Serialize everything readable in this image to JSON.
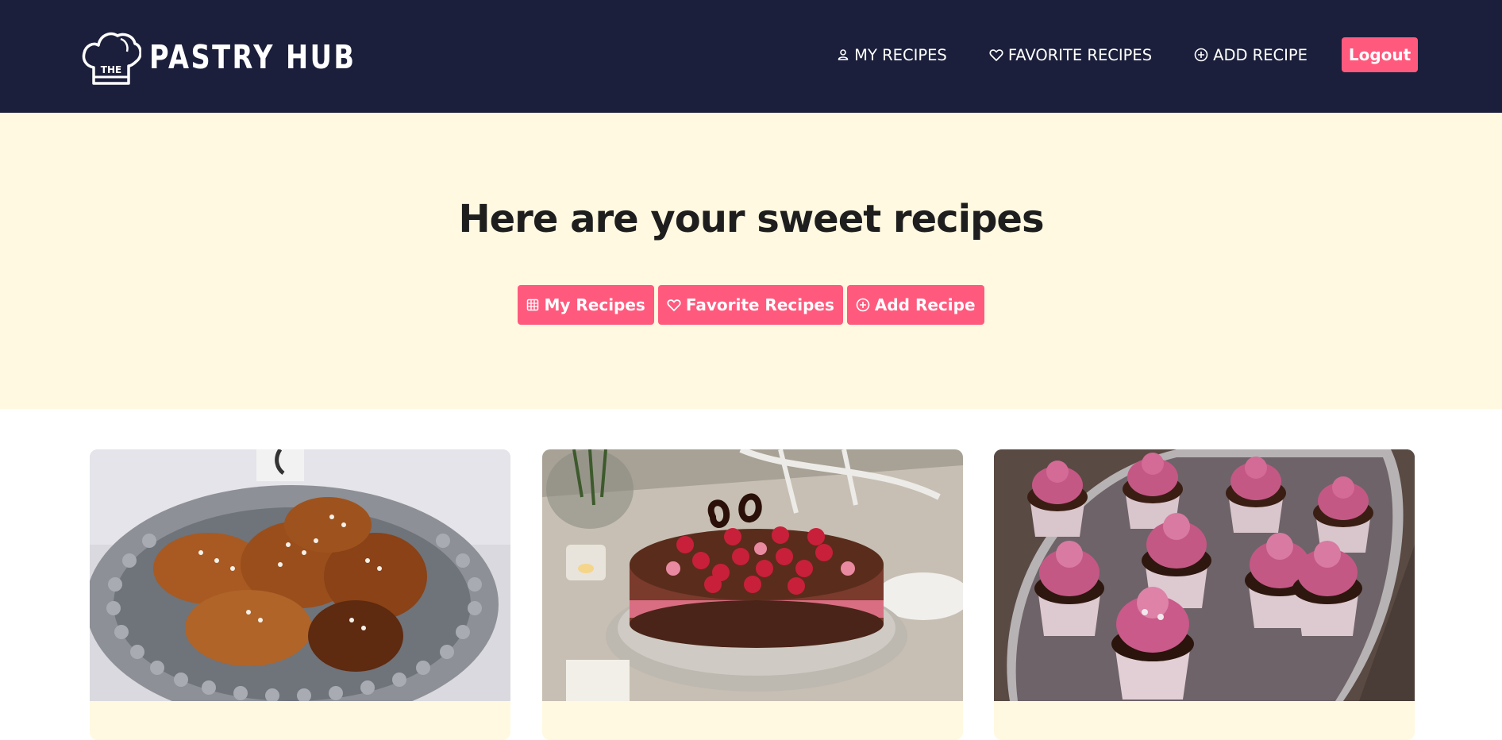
{
  "navbar": {
    "brand_small": "THE",
    "brand_name": "PASTRY HUB",
    "links": [
      {
        "label": "MY RECIPES",
        "icon": "user-icon"
      },
      {
        "label": "FAVORITE RECIPES",
        "icon": "heart-icon"
      },
      {
        "label": "ADD RECIPE",
        "icon": "plus-circle-icon"
      }
    ],
    "logout_label": "Logout"
  },
  "hero": {
    "title": "Here are your sweet recipes",
    "buttons": [
      {
        "label": "My Recipes",
        "icon": "grid-icon"
      },
      {
        "label": "Favorite Recipes",
        "icon": "heart-icon"
      },
      {
        "label": "Add Recipe",
        "icon": "plus-circle-icon"
      }
    ]
  },
  "recipes": [
    {
      "image": "cinnamon-buns-photo"
    },
    {
      "image": "raspberry-chocolate-cake-photo"
    },
    {
      "image": "pink-frosted-cupcakes-photo"
    }
  ],
  "colors": {
    "navbar_bg": "#1b1f3b",
    "accent": "#ff5a7e",
    "hero_bg": "#fef9e0"
  }
}
